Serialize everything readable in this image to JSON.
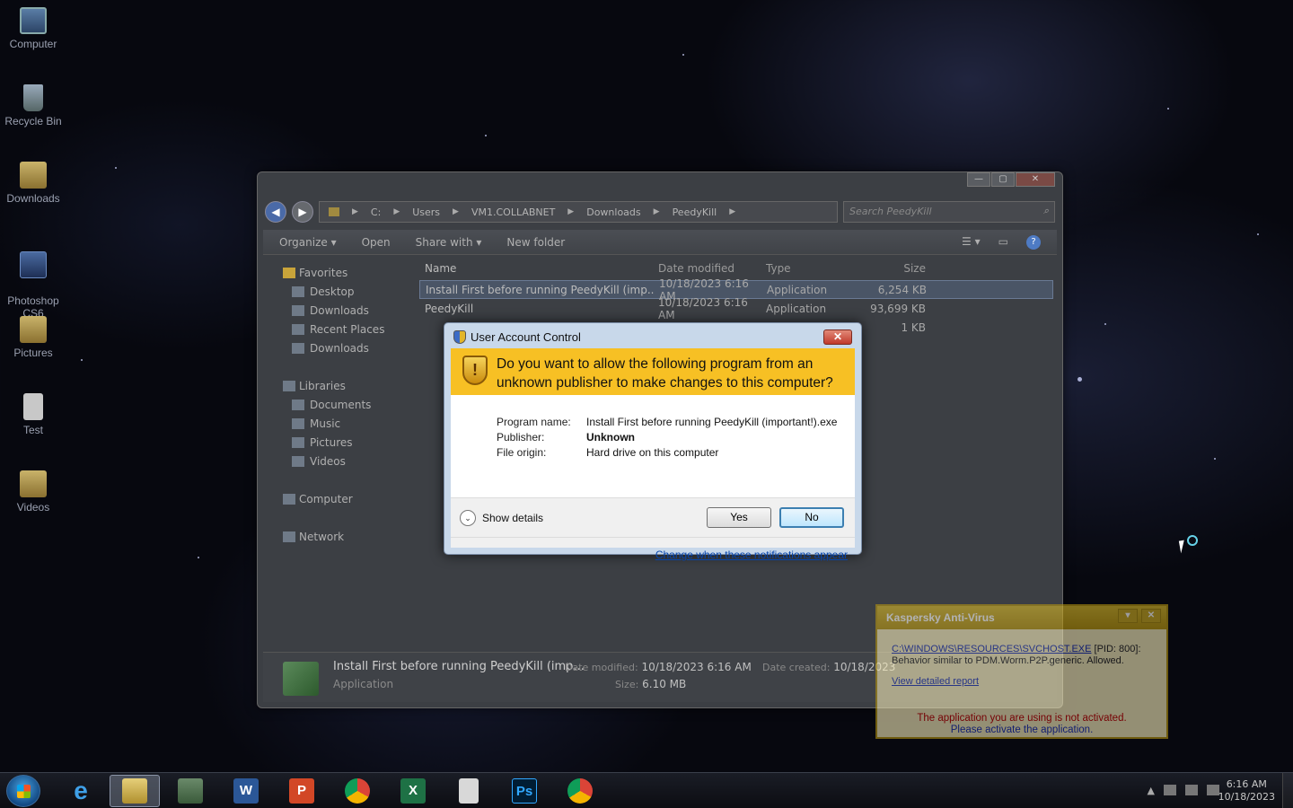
{
  "desktop": {
    "icons": [
      {
        "label": "Computer",
        "icon": "computer-icon"
      },
      {
        "label": "Recycle Bin",
        "icon": "recycle-bin-icon"
      },
      {
        "label": "Downloads",
        "icon": "folder-icon"
      },
      {
        "label": "Photoshop\nCS6",
        "icon": "photoshop-icon"
      },
      {
        "label": "Pictures",
        "icon": "folder-icon"
      },
      {
        "label": "Test",
        "icon": "document-icon"
      },
      {
        "label": "Videos",
        "icon": "folder-icon"
      }
    ]
  },
  "explorer": {
    "address": [
      "C:",
      "Users",
      "VM1.COLLABNET",
      "Downloads",
      "PeedyKill"
    ],
    "search_placeholder": "Search PeedyKill",
    "toolbar": {
      "organize": "Organize ▾",
      "open": "Open",
      "share": "Share with ▾",
      "new_folder": "New folder"
    },
    "navpane": {
      "favorites": "Favorites",
      "desktop": "Desktop",
      "downloads": "Downloads",
      "recent": "Recent Places",
      "downloads2": "Downloads",
      "libraries": "Libraries",
      "documents": "Documents",
      "music": "Music",
      "pictures": "Pictures",
      "videos": "Videos",
      "computer": "Computer",
      "network": "Network"
    },
    "columns": {
      "name": "Name",
      "date": "Date modified",
      "type": "Type",
      "size": "Size"
    },
    "files": [
      {
        "name": "Install First before running PeedyKill (imp...",
        "date": "10/18/2023 6:16 AM",
        "type": "Application",
        "size": "6,254 KB"
      },
      {
        "name": "PeedyKill",
        "date": "10/18/2023 6:16 AM",
        "type": "Application",
        "size": "93,699 KB"
      },
      {
        "name": "",
        "date": "",
        "type": "",
        "size": "1 KB"
      }
    ],
    "details": {
      "name": "Install First before running PeedyKill (imp...",
      "kind": "Application",
      "modified_label": "Date modified:",
      "modified": "10/18/2023 6:16 AM",
      "created_label": "Date created:",
      "created": "10/18/2023",
      "size_label": "Size:",
      "size": "6.10 MB"
    }
  },
  "uac": {
    "title": "User Account Control",
    "question": "Do you want to allow the following program from an unknown publisher to make changes to this computer?",
    "program_label": "Program name:",
    "program": "Install First before running PeedyKill (important!).exe",
    "publisher_label": "Publisher:",
    "publisher": "Unknown",
    "origin_label": "File origin:",
    "origin": "Hard drive on this computer",
    "show_details": "Show details",
    "yes": "Yes",
    "no": "No",
    "link": "Change when these notifications appear"
  },
  "kaspersky": {
    "title": "Kaspersky Anti-Virus",
    "path": "C:\\WINDOWS\\RESOURCES\\SVCHOST.EXE",
    "pid": " [PID: 800]:",
    "behavior": "Behavior similar to PDM.Worm.P2P.generic. Allowed.",
    "report": "View detailed report",
    "warn1": "The application you are using is not activated.",
    "warn2": "Please activate the application."
  },
  "taskbar": {
    "apps": [
      "Internet Explorer",
      "File Explorer",
      "Remote Desktop",
      "Word",
      "PowerPoint",
      "Chrome",
      "Excel",
      "Notepad",
      "Photoshop",
      "Chrome"
    ],
    "time": "6:16 AM",
    "date": "10/18/2023"
  }
}
